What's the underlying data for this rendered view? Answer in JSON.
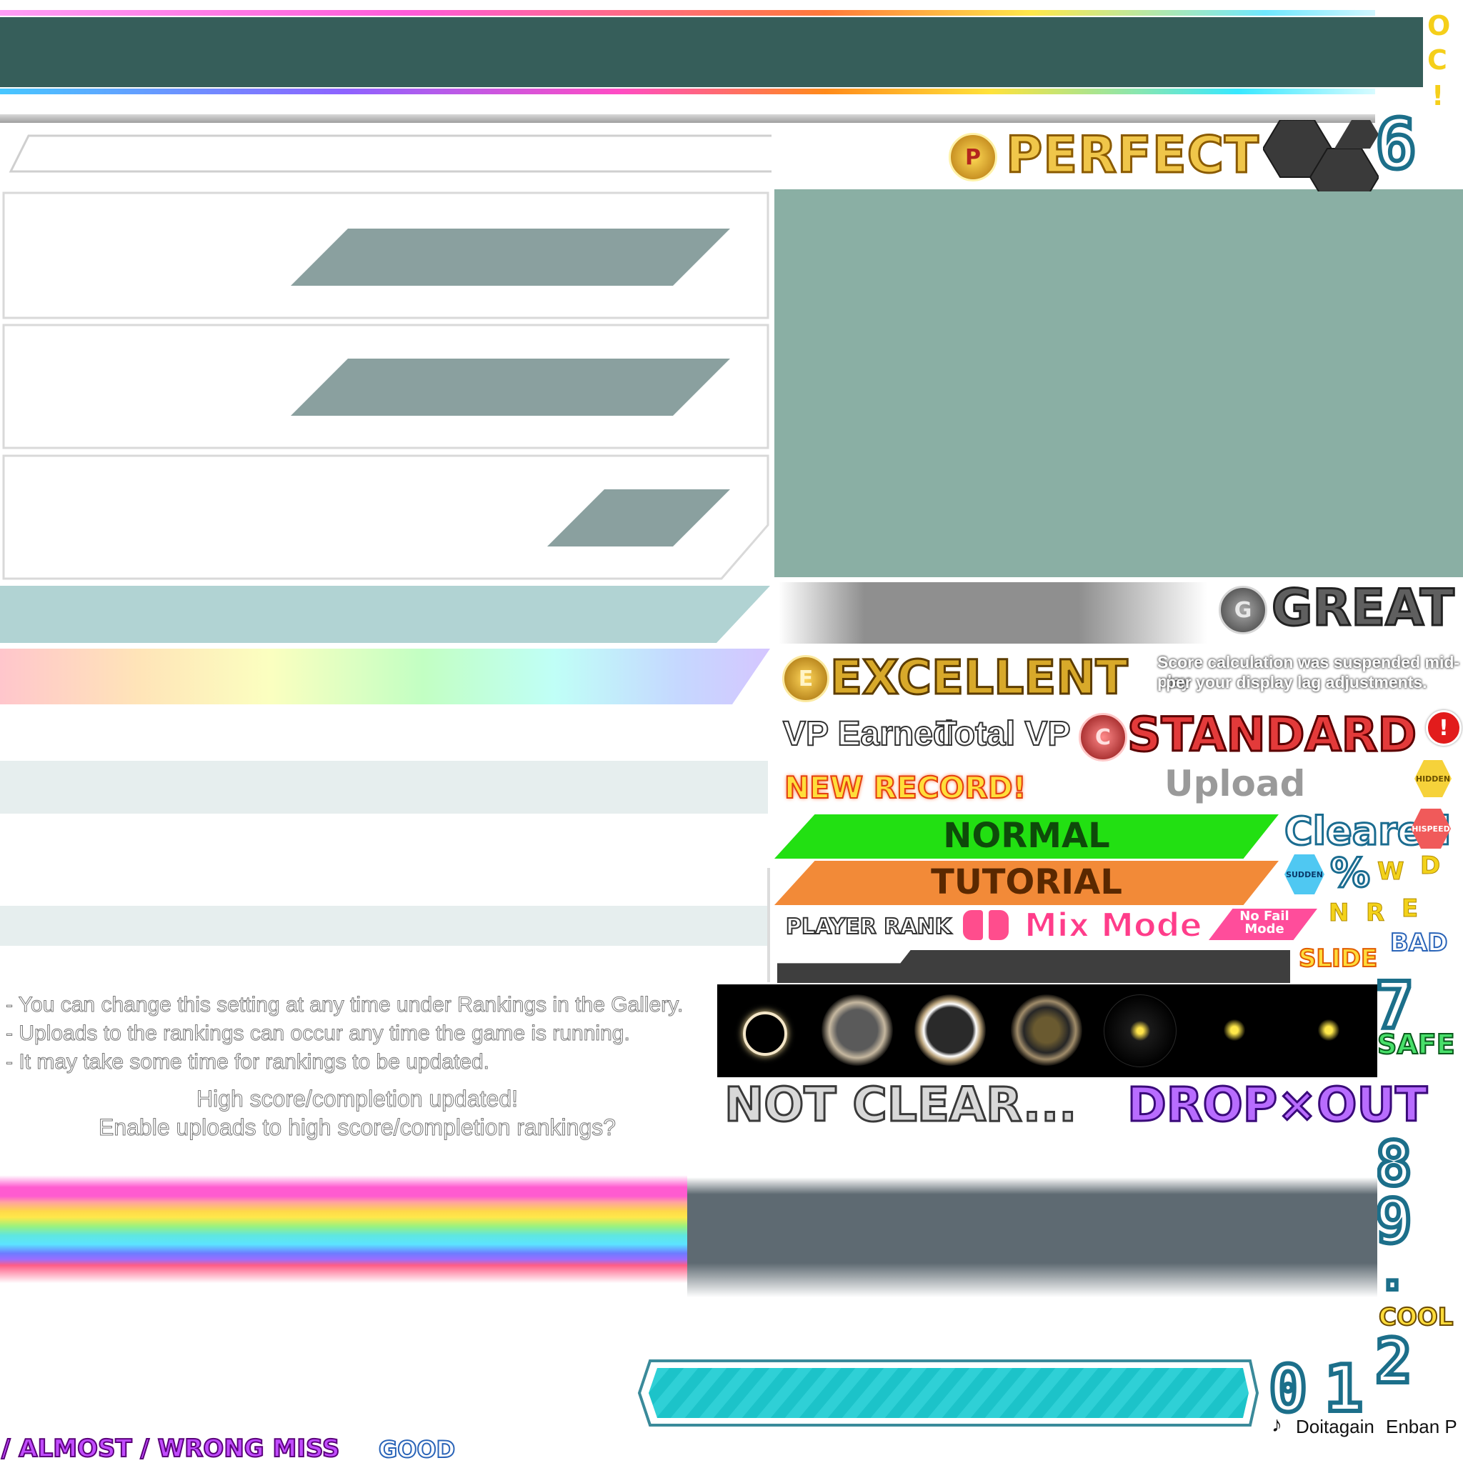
{
  "judgements": {
    "perfect": "PERFECT",
    "great": "GREAT",
    "excellent": "EXCELLENT",
    "standard": "STANDARD",
    "not_clear": "NOT CLEAR...",
    "drop_out": "DROP×OUT",
    "cool": "COOL",
    "safe": "SAFE",
    "bad": "BAD",
    "slide": "SLIDE",
    "good": "GOOD",
    "bottom_row": "/ ALMOST / WRONG MISS"
  },
  "medals": {
    "perfect": "P",
    "great": "G",
    "excellent": "E",
    "standard": "C"
  },
  "notice": {
    "line1": "Score calculation was suspended mid-play",
    "line2": "per your display lag adjustments."
  },
  "labels": {
    "vp_earned": "VP Earned",
    "total_vp": "Total VP",
    "new_record": "NEW RECORD!",
    "upload": "Upload",
    "cleared": "Cleared",
    "percent": "%",
    "player_rank": "PLAYER RANK",
    "mix_mode": "Mix Mode",
    "no_fail": "No Fail Mode"
  },
  "difficulty": {
    "normal": "NORMAL",
    "tutorial": "TUTORIAL"
  },
  "modifiers": {
    "hidden": "HIDDEN",
    "hispeed": "HISPEED",
    "sudden": "SUDDEN"
  },
  "letters": {
    "w": "W",
    "d": "D",
    "n": "N",
    "r": "R",
    "e": "E"
  },
  "top_right_chars": [
    "O",
    "C",
    "!"
  ],
  "digits": {
    "six": "6",
    "seven": "7",
    "eight": "8",
    "nine": "9",
    "dot": ".",
    "two": "2",
    "zero": "0",
    "one": "1"
  },
  "rankings_text": {
    "bullets": [
      "- You can change this setting at any time under Rankings in the Gallery.",
      "- Uploads to the rankings can occur any time the game is running.",
      "- It may take some time for rankings to be updated."
    ],
    "updated": "High score/completion updated!",
    "prompt": "Enable uploads to high score/completion rankings?"
  },
  "credits": {
    "note": "♪",
    "music": "Doitagain",
    "artist": "Enban P"
  },
  "colors": {
    "teal_dark": "#365e5a",
    "panel_green": "#8aafa4",
    "parallelogram": "#8aa09f",
    "normal_green": "#22e012",
    "tutorial_orange": "#f28a38",
    "cyan_bar": "#1cc3c9",
    "gold": "#d8a92a"
  }
}
